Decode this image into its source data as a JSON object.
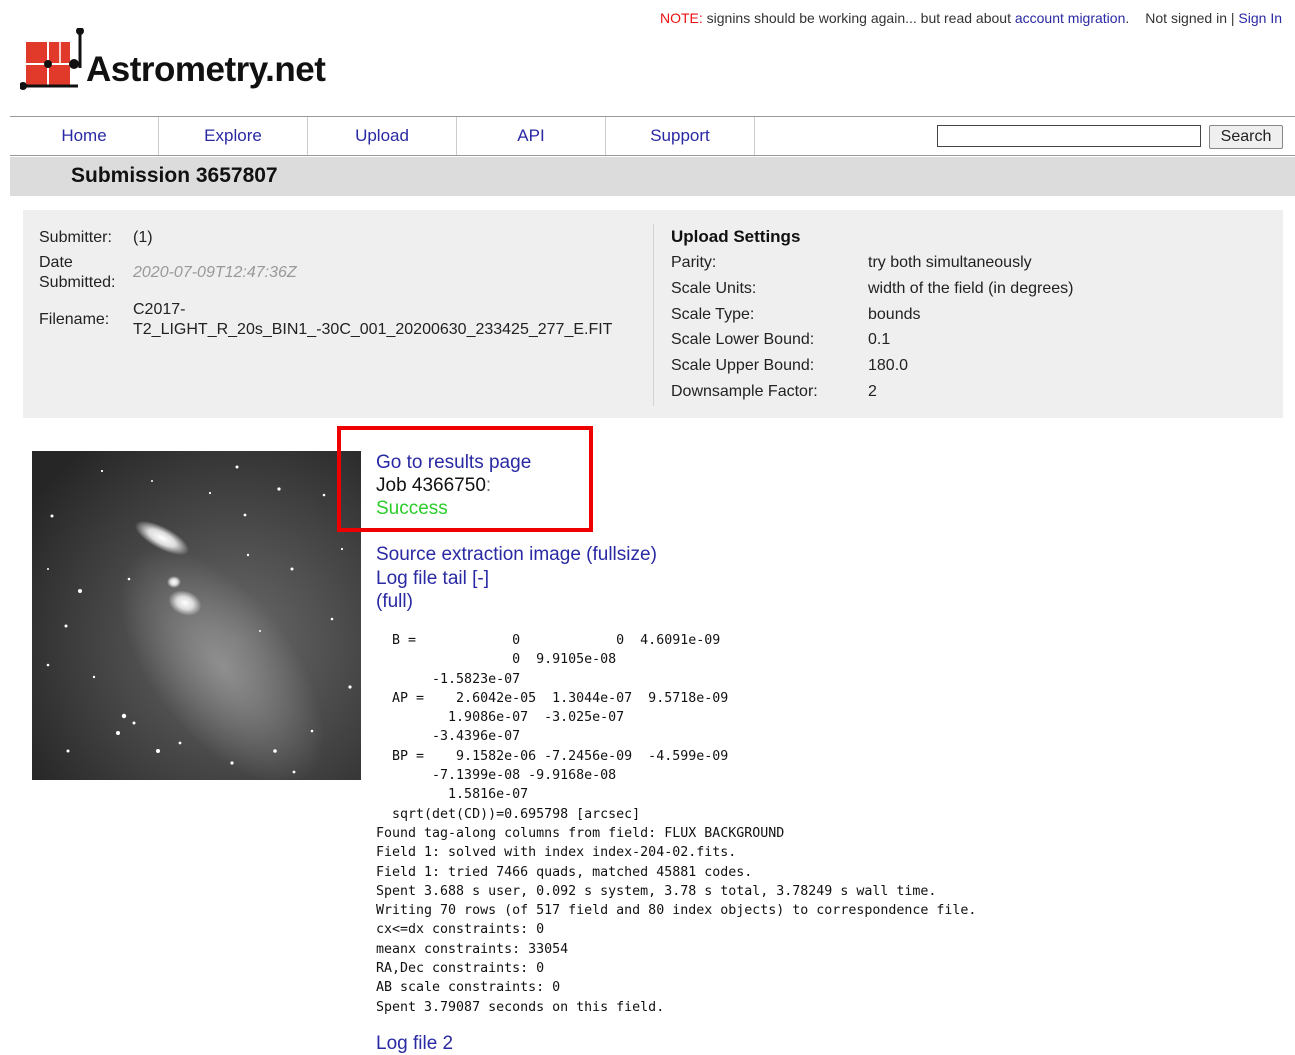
{
  "notice": {
    "label": "NOTE:",
    "text": " signins should be working again... but read about ",
    "link": "account migration",
    "after": ".",
    "signin_status": "Not signed in | ",
    "signin_link": "Sign In"
  },
  "logo": {
    "text": "Astrometry.net"
  },
  "nav": {
    "items": [
      "Home",
      "Explore",
      "Upload",
      "API",
      "Support"
    ],
    "search_value": "",
    "search_button": "Search"
  },
  "page": {
    "title": "Submission 3657807"
  },
  "submission": {
    "submitter_label": "Submitter:",
    "submitter_value": "(1)",
    "date_label_1": "Date",
    "date_label_2": "Submitted:",
    "date_value": "2020-07-09T12:47:36Z",
    "filename_label": "Filename:",
    "filename_line1": "C2017-",
    "filename_line2": "T2_LIGHT_R_20s_BIN1_-30C_001_20200630_233425_277_E.FIT"
  },
  "settings": {
    "heading": "Upload Settings",
    "rows": [
      {
        "label": "Parity:",
        "value": "try both simultaneously"
      },
      {
        "label": "Scale Units:",
        "value": "width of the field (in degrees)"
      },
      {
        "label": "Scale Type:",
        "value": "bounds"
      },
      {
        "label": "Scale Lower Bound:",
        "value": "0.1"
      },
      {
        "label": "Scale Upper Bound:",
        "value": "180.0"
      },
      {
        "label": "Downsample Factor:",
        "value": "2"
      }
    ]
  },
  "job": {
    "results_link": "Go to results page",
    "job_label": "Job 4366750",
    "job_suffix": ":",
    "status": "Success",
    "status_color": "#2bcc2b",
    "source_link": "Source extraction image (fullsize)",
    "log_tail_link": "Log file tail [-]",
    "full_link": "(full)",
    "log2_link": "Log file 2"
  },
  "log_text": "  B =            0            0  4.6091e-09\n                 0  9.9105e-08\n       -1.5823e-07\n  AP =    2.6042e-05  1.3044e-07  9.5718e-09\n         1.9086e-07  -3.025e-07\n       -3.4396e-07\n  BP =    9.1582e-06 -7.2456e-09  -4.599e-09\n       -7.1399e-08 -9.9168e-08\n         1.5816e-07\n  sqrt(det(CD))=0.695798 [arcsec]\nFound tag-along columns from field: FLUX BACKGROUND\nField 1: solved with index index-204-02.fits.\nField 1: tried 7466 quads, matched 45881 codes.\nSpent 3.688 s user, 0.092 s system, 3.78 s total, 3.78249 s wall time.\nWriting 70 rows (of 517 field and 80 index objects) to correspondence file.\ncx<=dx constraints: 0\nmeanx constraints: 33054\nRA,Dec constraints: 0\nAB scale constraints: 0\nSpent 3.79087 seconds on this field."
}
